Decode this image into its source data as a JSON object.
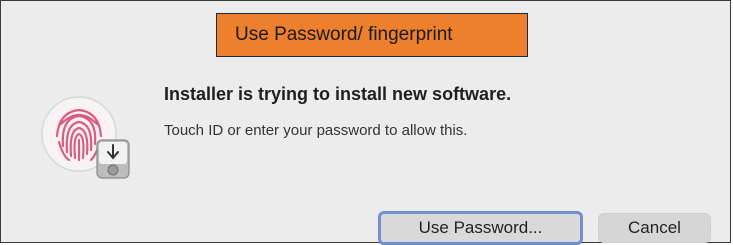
{
  "annotation": {
    "text": "Use Password/ fingerprint"
  },
  "dialog": {
    "title": "Installer is trying to install new software.",
    "message": "Touch ID or enter your password to allow this.",
    "primary_button": "Use Password...",
    "cancel_button": "Cancel",
    "icon": "touch-id-fingerprint-icon",
    "badge_icon": "installer-disk-icon"
  },
  "colors": {
    "annotation_bg": "#ee7f2d",
    "dialog_bg": "#ececec",
    "fingerprint": "#d75e7f",
    "focus_ring": "#6f8fcf"
  }
}
